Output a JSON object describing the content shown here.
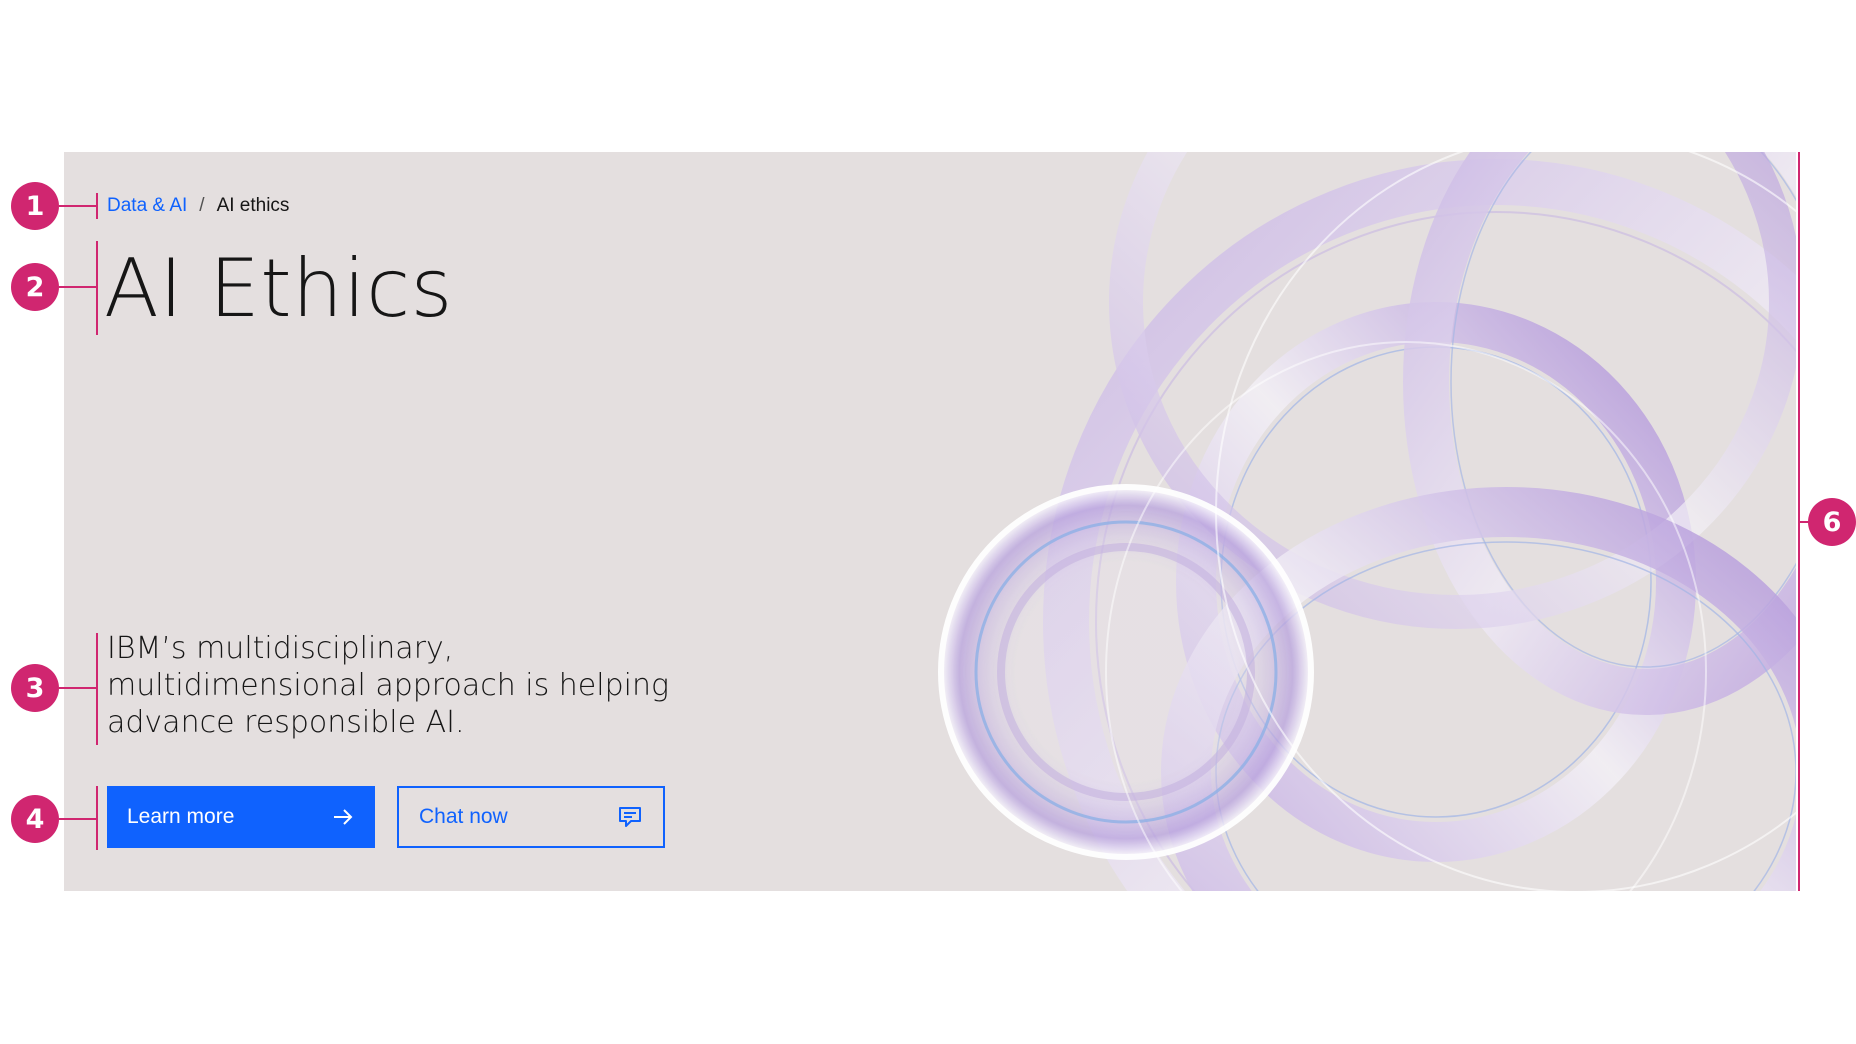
{
  "breadcrumb": {
    "parent_label": "Data & AI",
    "separator": "/",
    "current_label": "AI ethics"
  },
  "hero": {
    "title": "AI Ethics",
    "description": "IBM’s multidisciplinary, multidimensional approach is helping advance responsible AI.",
    "primary_button": {
      "label": "Learn more",
      "icon": "arrow-right-icon"
    },
    "secondary_button": {
      "label": "Chat now",
      "icon": "chat-icon"
    },
    "image": "purple-rings-abstract"
  },
  "annotations": [
    "1",
    "2",
    "3",
    "4",
    "6"
  ],
  "colors": {
    "accent": "#0f62fe",
    "annotation": "#d02670",
    "hero_background": "#e4dfdf"
  }
}
